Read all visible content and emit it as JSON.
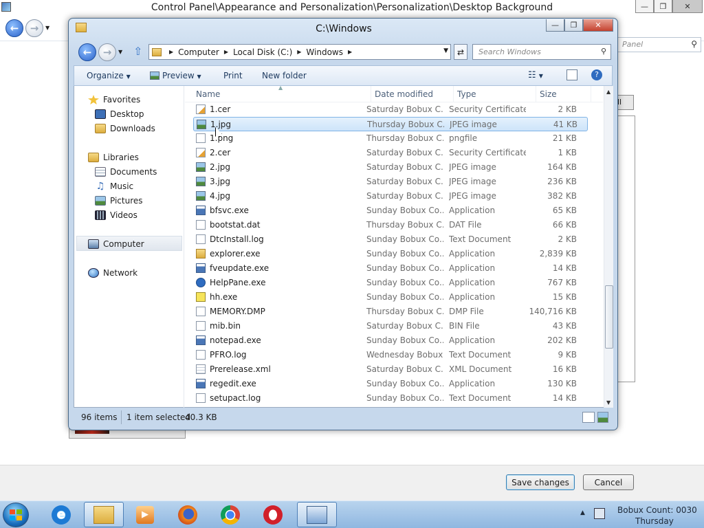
{
  "background": {
    "window_title": "Control Panel\\Appearance and Personalization\\Personalization\\Desktop Background",
    "search_placeholder": "Panel",
    "all_button": "ll",
    "save_button": "Save changes",
    "cancel_button": "Cancel"
  },
  "dialog": {
    "title": "C:\\Windows",
    "breadcrumb": [
      "Computer",
      "Local Disk (C:)",
      "Windows"
    ],
    "search_placeholder": "Search Windows",
    "toolbar": {
      "organize": "Organize",
      "preview": "Preview",
      "print": "Print",
      "new_folder": "New folder"
    },
    "nav": {
      "favorites": "Favorites",
      "desktop": "Desktop",
      "downloads": "Downloads",
      "libraries": "Libraries",
      "documents": "Documents",
      "music": "Music",
      "pictures": "Pictures",
      "videos": "Videos",
      "computer": "Computer",
      "network": "Network"
    },
    "columns": {
      "name": "Name",
      "date": "Date modified",
      "type": "Type",
      "size": "Size"
    },
    "files": [
      {
        "name": "1.cer",
        "date": "Saturday Bobux C...",
        "type": "Security Certificate",
        "size": "2 KB",
        "icon": "cer"
      },
      {
        "name": "1.jpg",
        "date": "Thursday Bobux C...",
        "type": "JPEG image",
        "size": "41 KB",
        "icon": "img"
      },
      {
        "name": "1.png",
        "date": "Thursday Bobux C...",
        "type": "pngfile",
        "size": "21 KB",
        "icon": "doc"
      },
      {
        "name": "2.cer",
        "date": "Saturday Bobux C...",
        "type": "Security Certificate",
        "size": "1 KB",
        "icon": "cer"
      },
      {
        "name": "2.jpg",
        "date": "Saturday Bobux C...",
        "type": "JPEG image",
        "size": "164 KB",
        "icon": "img"
      },
      {
        "name": "3.jpg",
        "date": "Saturday Bobux C...",
        "type": "JPEG image",
        "size": "236 KB",
        "icon": "img"
      },
      {
        "name": "4.jpg",
        "date": "Saturday Bobux C...",
        "type": "JPEG image",
        "size": "382 KB",
        "icon": "img"
      },
      {
        "name": "bfsvc.exe",
        "date": "Sunday Bobux Co...",
        "type": "Application",
        "size": "65 KB",
        "icon": "exe"
      },
      {
        "name": "bootstat.dat",
        "date": "Thursday Bobux C...",
        "type": "DAT File",
        "size": "66 KB",
        "icon": "doc"
      },
      {
        "name": "DtcInstall.log",
        "date": "Sunday Bobux Co...",
        "type": "Text Document",
        "size": "2 KB",
        "icon": "doc"
      },
      {
        "name": "explorer.exe",
        "date": "Sunday Bobux Co...",
        "type": "Application",
        "size": "2,839 KB",
        "icon": "folder"
      },
      {
        "name": "fveupdate.exe",
        "date": "Sunday Bobux Co...",
        "type": "Application",
        "size": "14 KB",
        "icon": "exe"
      },
      {
        "name": "HelpPane.exe",
        "date": "Sunday Bobux Co...",
        "type": "Application",
        "size": "767 KB",
        "icon": "help"
      },
      {
        "name": "hh.exe",
        "date": "Sunday Bobux Co...",
        "type": "Application",
        "size": "15 KB",
        "icon": "q"
      },
      {
        "name": "MEMORY.DMP",
        "date": "Thursday Bobux C...",
        "type": "DMP File",
        "size": "140,716 KB",
        "icon": "doc"
      },
      {
        "name": "mib.bin",
        "date": "Saturday Bobux C...",
        "type": "BIN File",
        "size": "43 KB",
        "icon": "doc"
      },
      {
        "name": "notepad.exe",
        "date": "Sunday Bobux Co...",
        "type": "Application",
        "size": "202 KB",
        "icon": "exe"
      },
      {
        "name": "PFRO.log",
        "date": "Wednesday Bobux...",
        "type": "Text Document",
        "size": "9 KB",
        "icon": "doc"
      },
      {
        "name": "Prerelease.xml",
        "date": "Saturday Bobux C...",
        "type": "XML Document",
        "size": "16 KB",
        "icon": "xml"
      },
      {
        "name": "regedit.exe",
        "date": "Sunday Bobux Co...",
        "type": "Application",
        "size": "130 KB",
        "icon": "exe"
      },
      {
        "name": "setupact.log",
        "date": "Sunday Bobux Co...",
        "type": "Text Document",
        "size": "14 KB",
        "icon": "doc"
      }
    ],
    "status": {
      "count": "96 items",
      "selection": "1 item selected",
      "selection_size": "40.3 KB"
    }
  },
  "taskbar": {
    "clock_line1": "Bobux Count: 0030",
    "clock_line2": "Thursday"
  }
}
